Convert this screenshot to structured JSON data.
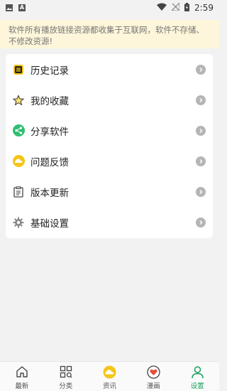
{
  "status_bar": {
    "time": "2:59",
    "left_icons": [
      "image-icon",
      "a-letter-icon"
    ],
    "a_letter": "A",
    "right_icons": [
      "wifi-icon",
      "no-signal-icon",
      "battery-charging-icon"
    ]
  },
  "notice": {
    "text": "软件所有播放链接资源都收集于互联网，软件不存储、不修改资源!"
  },
  "menu": {
    "items": [
      {
        "label": "历史记录",
        "icon": "history-icon",
        "color": "#f5c518"
      },
      {
        "label": "我的收藏",
        "icon": "favorite-star-icon",
        "color": "#f5c518"
      },
      {
        "label": "分享软件",
        "icon": "share-icon",
        "color": "#2fbf71"
      },
      {
        "label": "问题反馈",
        "icon": "feedback-cloud-icon",
        "color": "#f5c518"
      },
      {
        "label": "版本更新",
        "icon": "clipboard-icon",
        "color": "#555555"
      },
      {
        "label": "基础设置",
        "icon": "settings-gear-icon",
        "color": "#888888"
      }
    ]
  },
  "bottom_nav": {
    "items": [
      {
        "label": "最新",
        "icon": "home-icon"
      },
      {
        "label": "分类",
        "icon": "category-grid-icon"
      },
      {
        "label": "资讯",
        "icon": "news-cloud-icon"
      },
      {
        "label": "漫画",
        "icon": "comic-heart-icon"
      },
      {
        "label": "设置",
        "icon": "user-icon",
        "active": true
      }
    ],
    "active_color": "#1aa05a"
  }
}
